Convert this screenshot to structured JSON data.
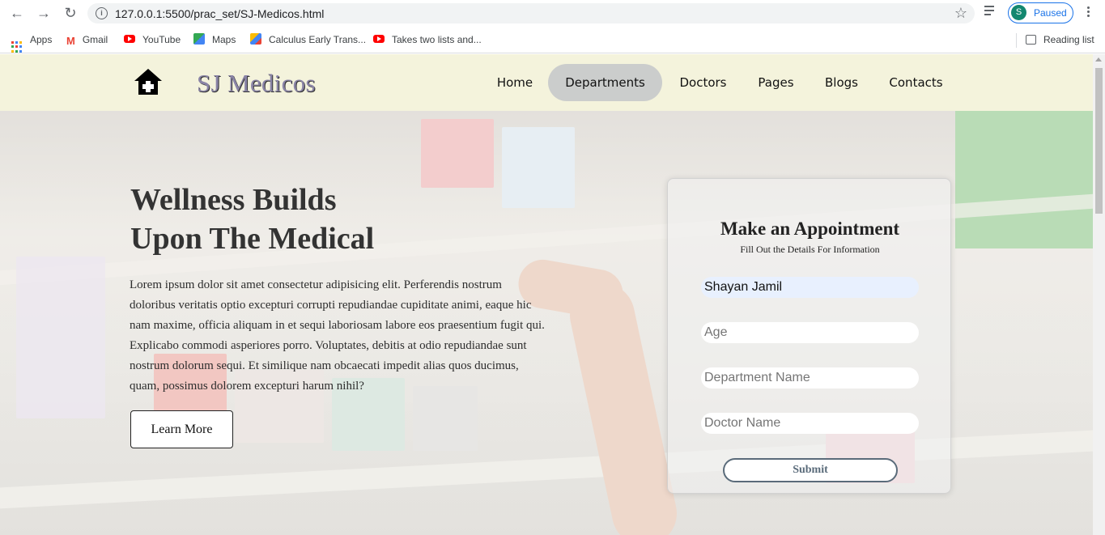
{
  "browser": {
    "url": "127.0.0.1:5500/prac_set/SJ-Medicos.html",
    "profile_initial": "S",
    "profile_status": "Paused",
    "bookmarks": [
      {
        "label": "Apps",
        "icon": "apps-grid-icon"
      },
      {
        "label": "Gmail",
        "icon": "gmail-icon"
      },
      {
        "label": "YouTube",
        "icon": "youtube-icon"
      },
      {
        "label": "Maps",
        "icon": "maps-icon"
      },
      {
        "label": "Calculus Early Trans...",
        "icon": "calculus-site-icon"
      },
      {
        "label": "Takes two lists and...",
        "icon": "youtube-icon"
      }
    ],
    "reading_list": "Reading list"
  },
  "site": {
    "brand": "SJ Medicos",
    "nav": [
      {
        "label": "Home",
        "active": false
      },
      {
        "label": "Departments",
        "active": true
      },
      {
        "label": "Doctors",
        "active": false
      },
      {
        "label": "Pages",
        "active": false
      },
      {
        "label": "Blogs",
        "active": false
      },
      {
        "label": "Contacts",
        "active": false
      }
    ]
  },
  "hero": {
    "title_line1": "Wellness Builds",
    "title_line2": "Upon The Medical",
    "text": "Lorem ipsum dolor sit amet consectetur adipisicing elit. Perferendis nostrum doloribus veritatis optio excepturi corrupti repudiandae cupiditate animi, eaque hic nam maxime, officia aliquam in et sequi laboriosam labore eos praesentium fugit qui. Explicabo commodi asperiores porro. Voluptates, debitis at odio repudiandae sunt nostrum dolorum sequi. Et similique nam obcaecati impedit alias quos ducimus, quam, possimus dolorem excepturi harum nihil?",
    "button": "Learn More"
  },
  "appointment": {
    "title": "Make an Appointment",
    "subtitle": "Fill Out the Details For Information",
    "name_value": "Shayan Jamil",
    "age_placeholder": "Age",
    "department_placeholder": "Department Name",
    "doctor_placeholder": "Doctor Name",
    "submit": "Submit"
  },
  "colors": {
    "nav_bg": "#f4f3dc",
    "active_pill": "#cbcdcc",
    "brand_text": "#8a84a6",
    "chrome_accent": "#1a73e8"
  }
}
